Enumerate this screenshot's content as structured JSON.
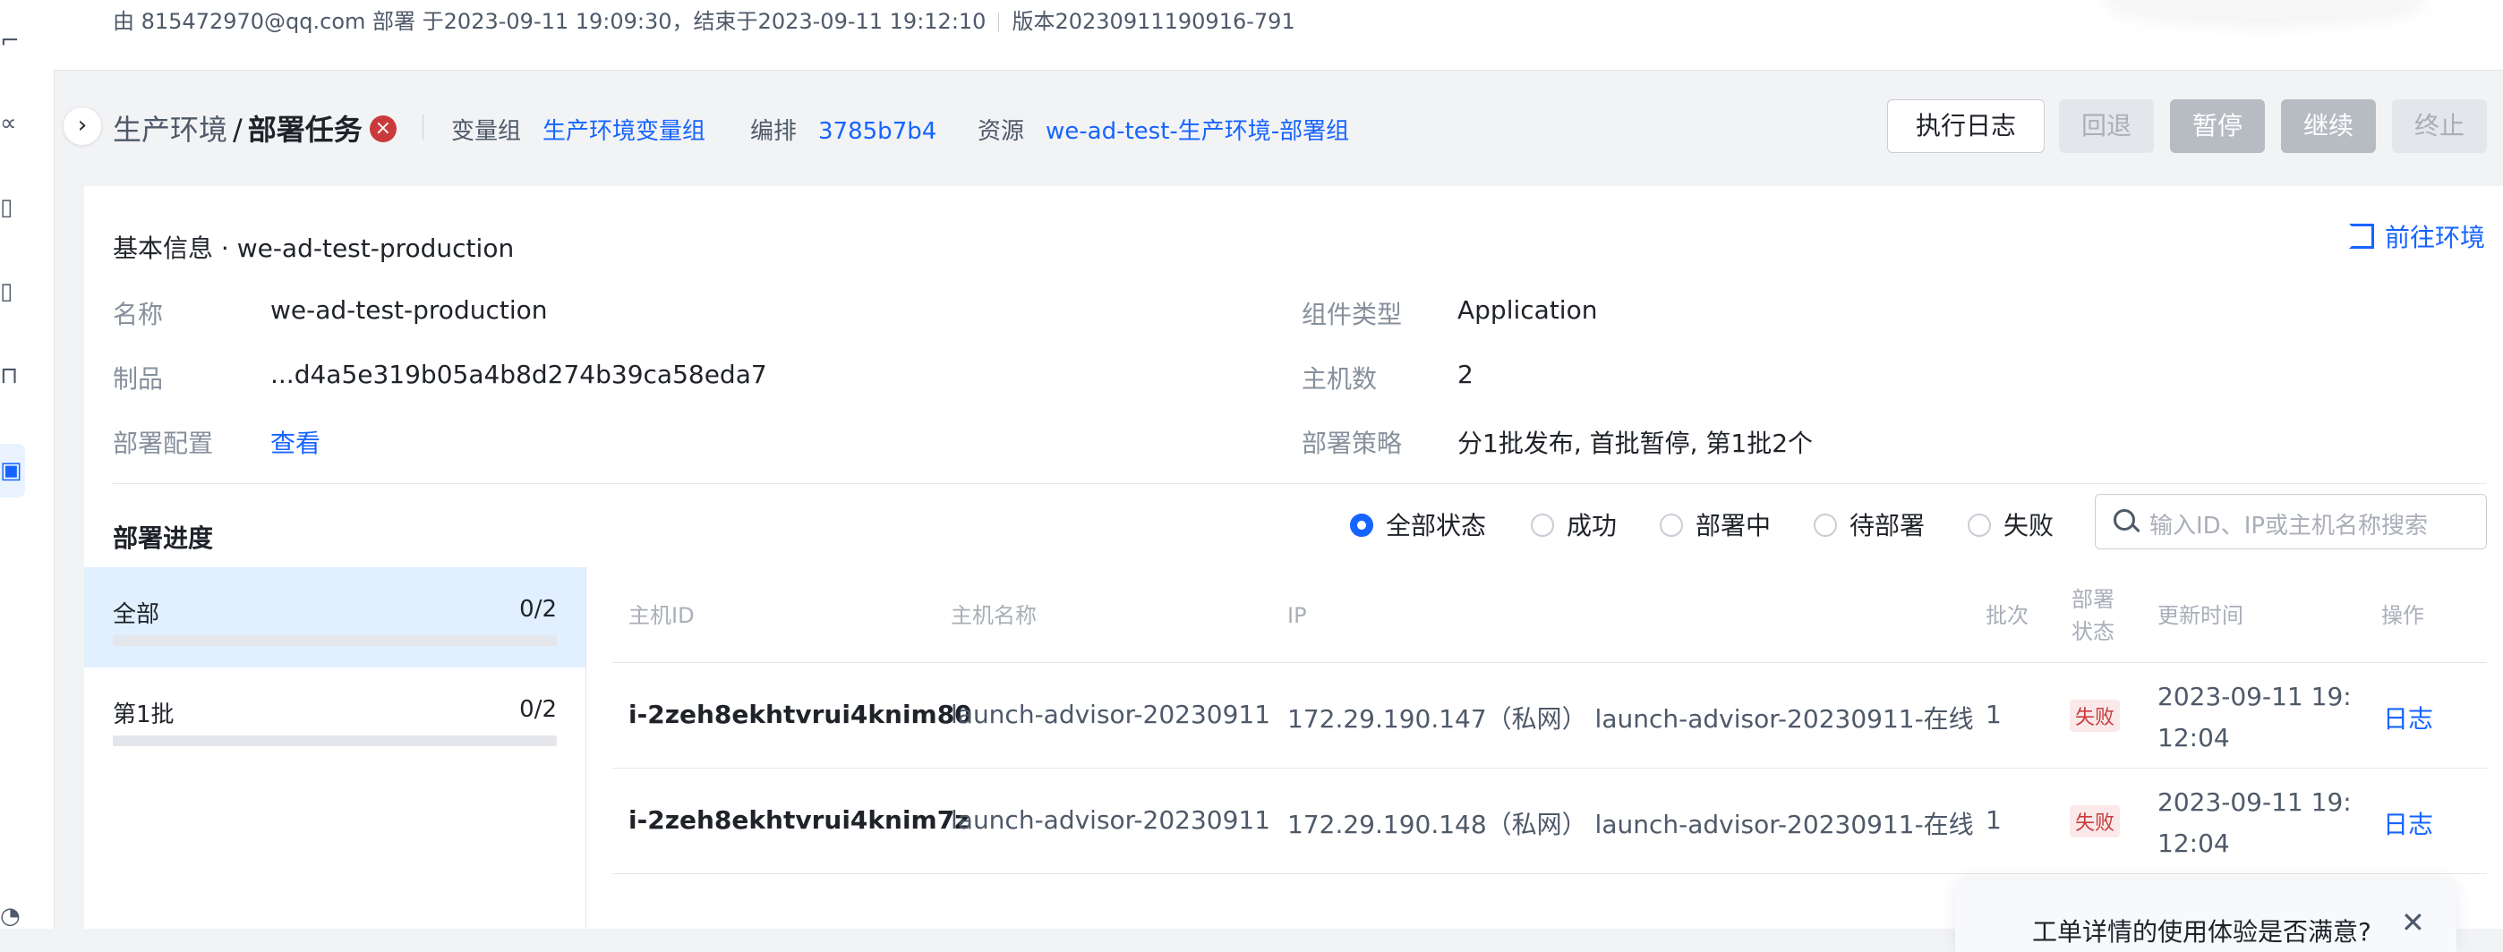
{
  "top_info": "由 815472970@qq.com 部署  于2023-09-11 19:09:30，结束于2023-09-11 19:12:10",
  "top_version": "版本20230911190916-791",
  "breadcrumb": {
    "env": "生产环境",
    "slash": "/",
    "task": "部署任务"
  },
  "header_meta": [
    {
      "key": "变量组",
      "value": "生产环境变量组"
    },
    {
      "key": "编排",
      "value": "3785b7b4"
    },
    {
      "key": "资源",
      "value": "we-ad-test-生产环境-部署组"
    }
  ],
  "actions": {
    "log": "执行日志",
    "rollback": "回退",
    "pause": "暂停",
    "continue": "继续",
    "stop": "终止"
  },
  "basic": {
    "title": "基本信息 · we-ad-test-production",
    "goto": "前往环境",
    "fields_left": [
      {
        "key": "名称",
        "value": "we-ad-test-production"
      },
      {
        "key": "制品",
        "value": "...d4a5e319b05a4b8d274b39ca58eda7"
      },
      {
        "key": "部署配置",
        "value": "查看"
      }
    ],
    "fields_right": [
      {
        "key": "组件类型",
        "value": "Application"
      },
      {
        "key": "主机数",
        "value": "2"
      },
      {
        "key": "部署策略",
        "value": "分1批发布, 首批暂停, 第1批2个"
      }
    ]
  },
  "progress": {
    "title": "部署进度",
    "filters": [
      "全部状态",
      "成功",
      "部署中",
      "待部署",
      "失败"
    ],
    "selected_filter": "全部状态",
    "search_placeholder": "输入ID、IP或主机名称搜索",
    "batches": [
      {
        "label": "全部",
        "count": "0/2",
        "progress": 0
      },
      {
        "label": "第1批",
        "count": "0/2",
        "progress": 0
      }
    ]
  },
  "table": {
    "headers": {
      "host_id": "主机ID",
      "host_name": "主机名称",
      "ip": "IP",
      "batch": "批次",
      "status_1": "部署",
      "status_2": "状态",
      "updated": "更新时间",
      "action": "操作"
    },
    "rows": [
      {
        "host_id": "i-2zeh8ekhtvrui4knim80",
        "host_name": "launch-advisor-20230911",
        "ip": "172.29.190.147（私网） launch-advisor-20230911-在线",
        "batch": "1",
        "status": "失败",
        "time_1": "2023-09-11 19:",
        "time_2": "12:04",
        "action": "日志"
      },
      {
        "host_id": "i-2zeh8ekhtvrui4knim7z",
        "host_name": "launch-advisor-20230911",
        "ip": "172.29.190.148（私网） launch-advisor-20230911-在线",
        "batch": "1",
        "status": "失败",
        "time_1": "2023-09-11 19:",
        "time_2": "12:04",
        "action": "日志"
      }
    ]
  },
  "toast": {
    "text": "工单详情的使用体验是否满意?",
    "close": "✕"
  },
  "colors": {
    "accent": "#1664ff",
    "danger": "#c93b3b",
    "page_bg": "#f2f3f5"
  }
}
